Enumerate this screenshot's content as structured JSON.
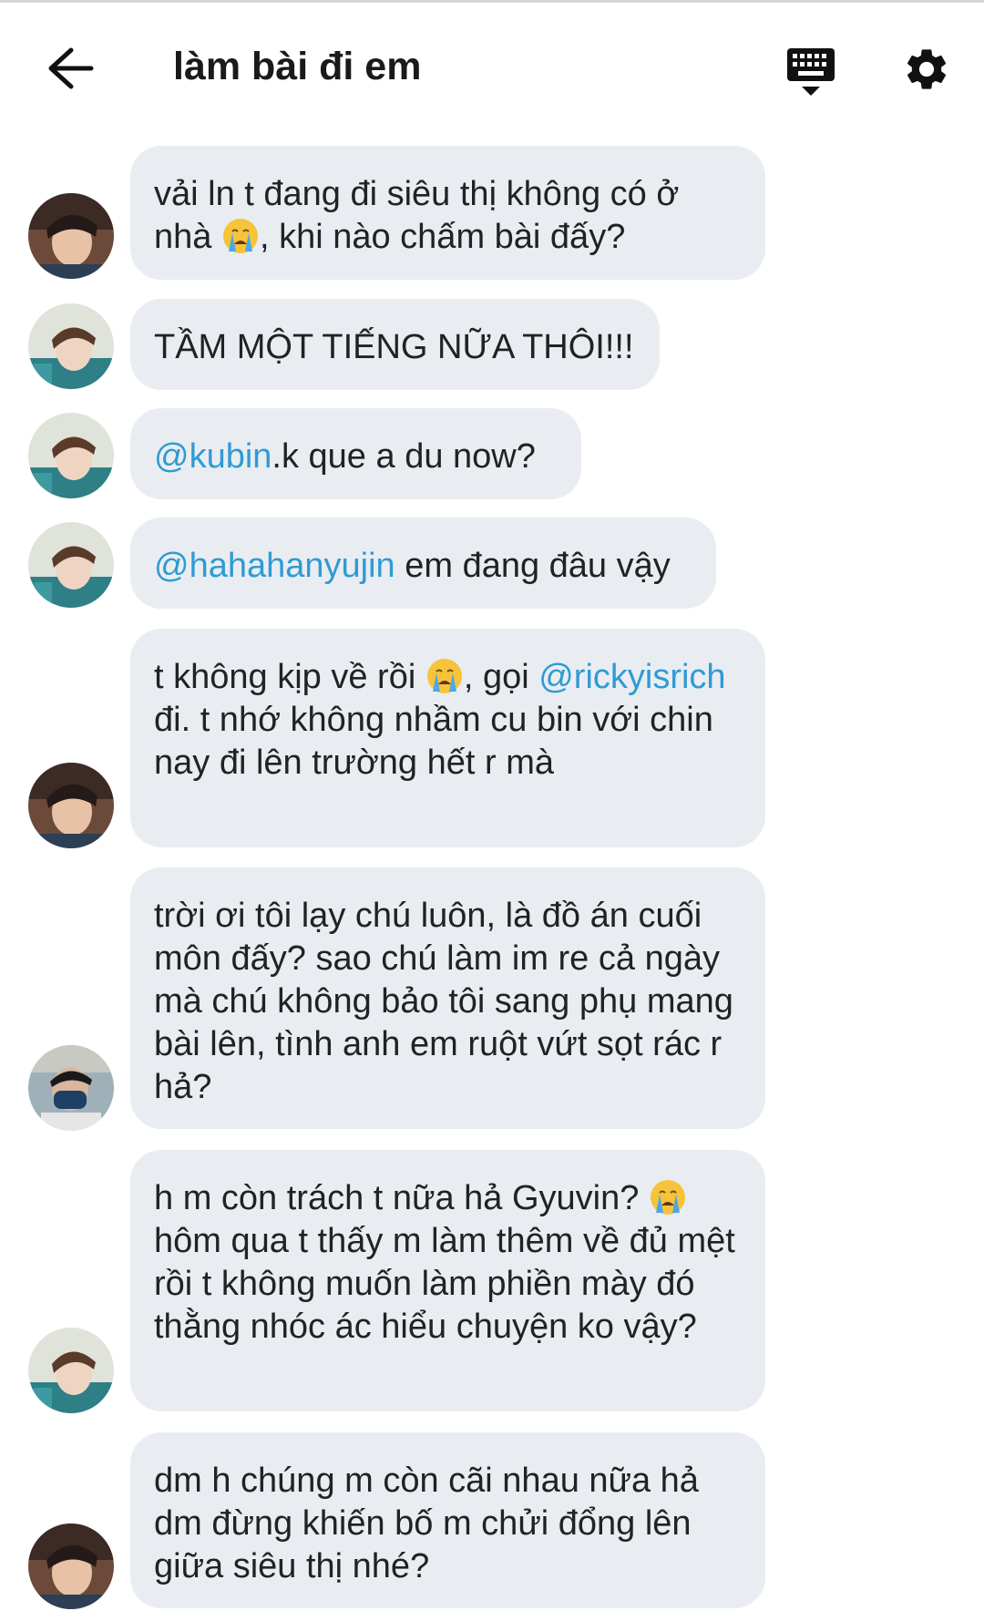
{
  "header": {
    "title": "làm bài đi em",
    "back_icon": "arrow-left-icon",
    "keyboard_icon": "keyboard-icon",
    "settings_icon": "gear-icon"
  },
  "messages": [
    {
      "avatar": "avatar-a",
      "parts": [
        "vải ln t đang đi siêu thị không có ở nhà ",
        "",
        ", khi nào chấm bài đấy?"
      ]
    },
    {
      "avatar": "avatar-b",
      "text": "TẦM MỘT TIẾNG NỮA THÔI!!!"
    },
    {
      "avatar": "avatar-b",
      "mention": "@kubin",
      "text": ".k que a du now?"
    },
    {
      "avatar": "avatar-b",
      "mention": "@hahahanyujin",
      "text": " em đang đâu vậy"
    },
    {
      "avatar": "avatar-a",
      "before": "t không kịp về rồi ",
      "after_emoji": ", gọi",
      "mention": "@rickyisrich",
      "text": " đi. t nhớ không nhầm cu bin với chin nay đi lên trường hết r mà"
    },
    {
      "avatar": "avatar-c",
      "text": "trời ơi tôi lạy chú luôn, là đồ án cuối môn đấy? sao chú làm im re cả ngày mà chú không bảo tôi sang phụ mang bài lên, tình anh em ruột vứt sọt rác r hả?"
    },
    {
      "avatar": "avatar-b",
      "text": "h m còn trách t nữa hả Gyuvin? ",
      "text2": "hôm qua t thấy m làm thêm về đủ mệt rồi t không muốn làm phiền mày đó thằng nhóc ác hiểu chuyện ko vậy?"
    },
    {
      "avatar": "avatar-a",
      "text": "dm h chúng m còn cãi nhau nữa hả dm đừng khiến bố m chửi đổng lên giữa siêu thị nhé?"
    }
  ],
  "emoji_name": "crying-face-emoji",
  "colors": {
    "bubble": "#e9edf2",
    "mention": "#2f9bd3",
    "text": "#222222"
  }
}
